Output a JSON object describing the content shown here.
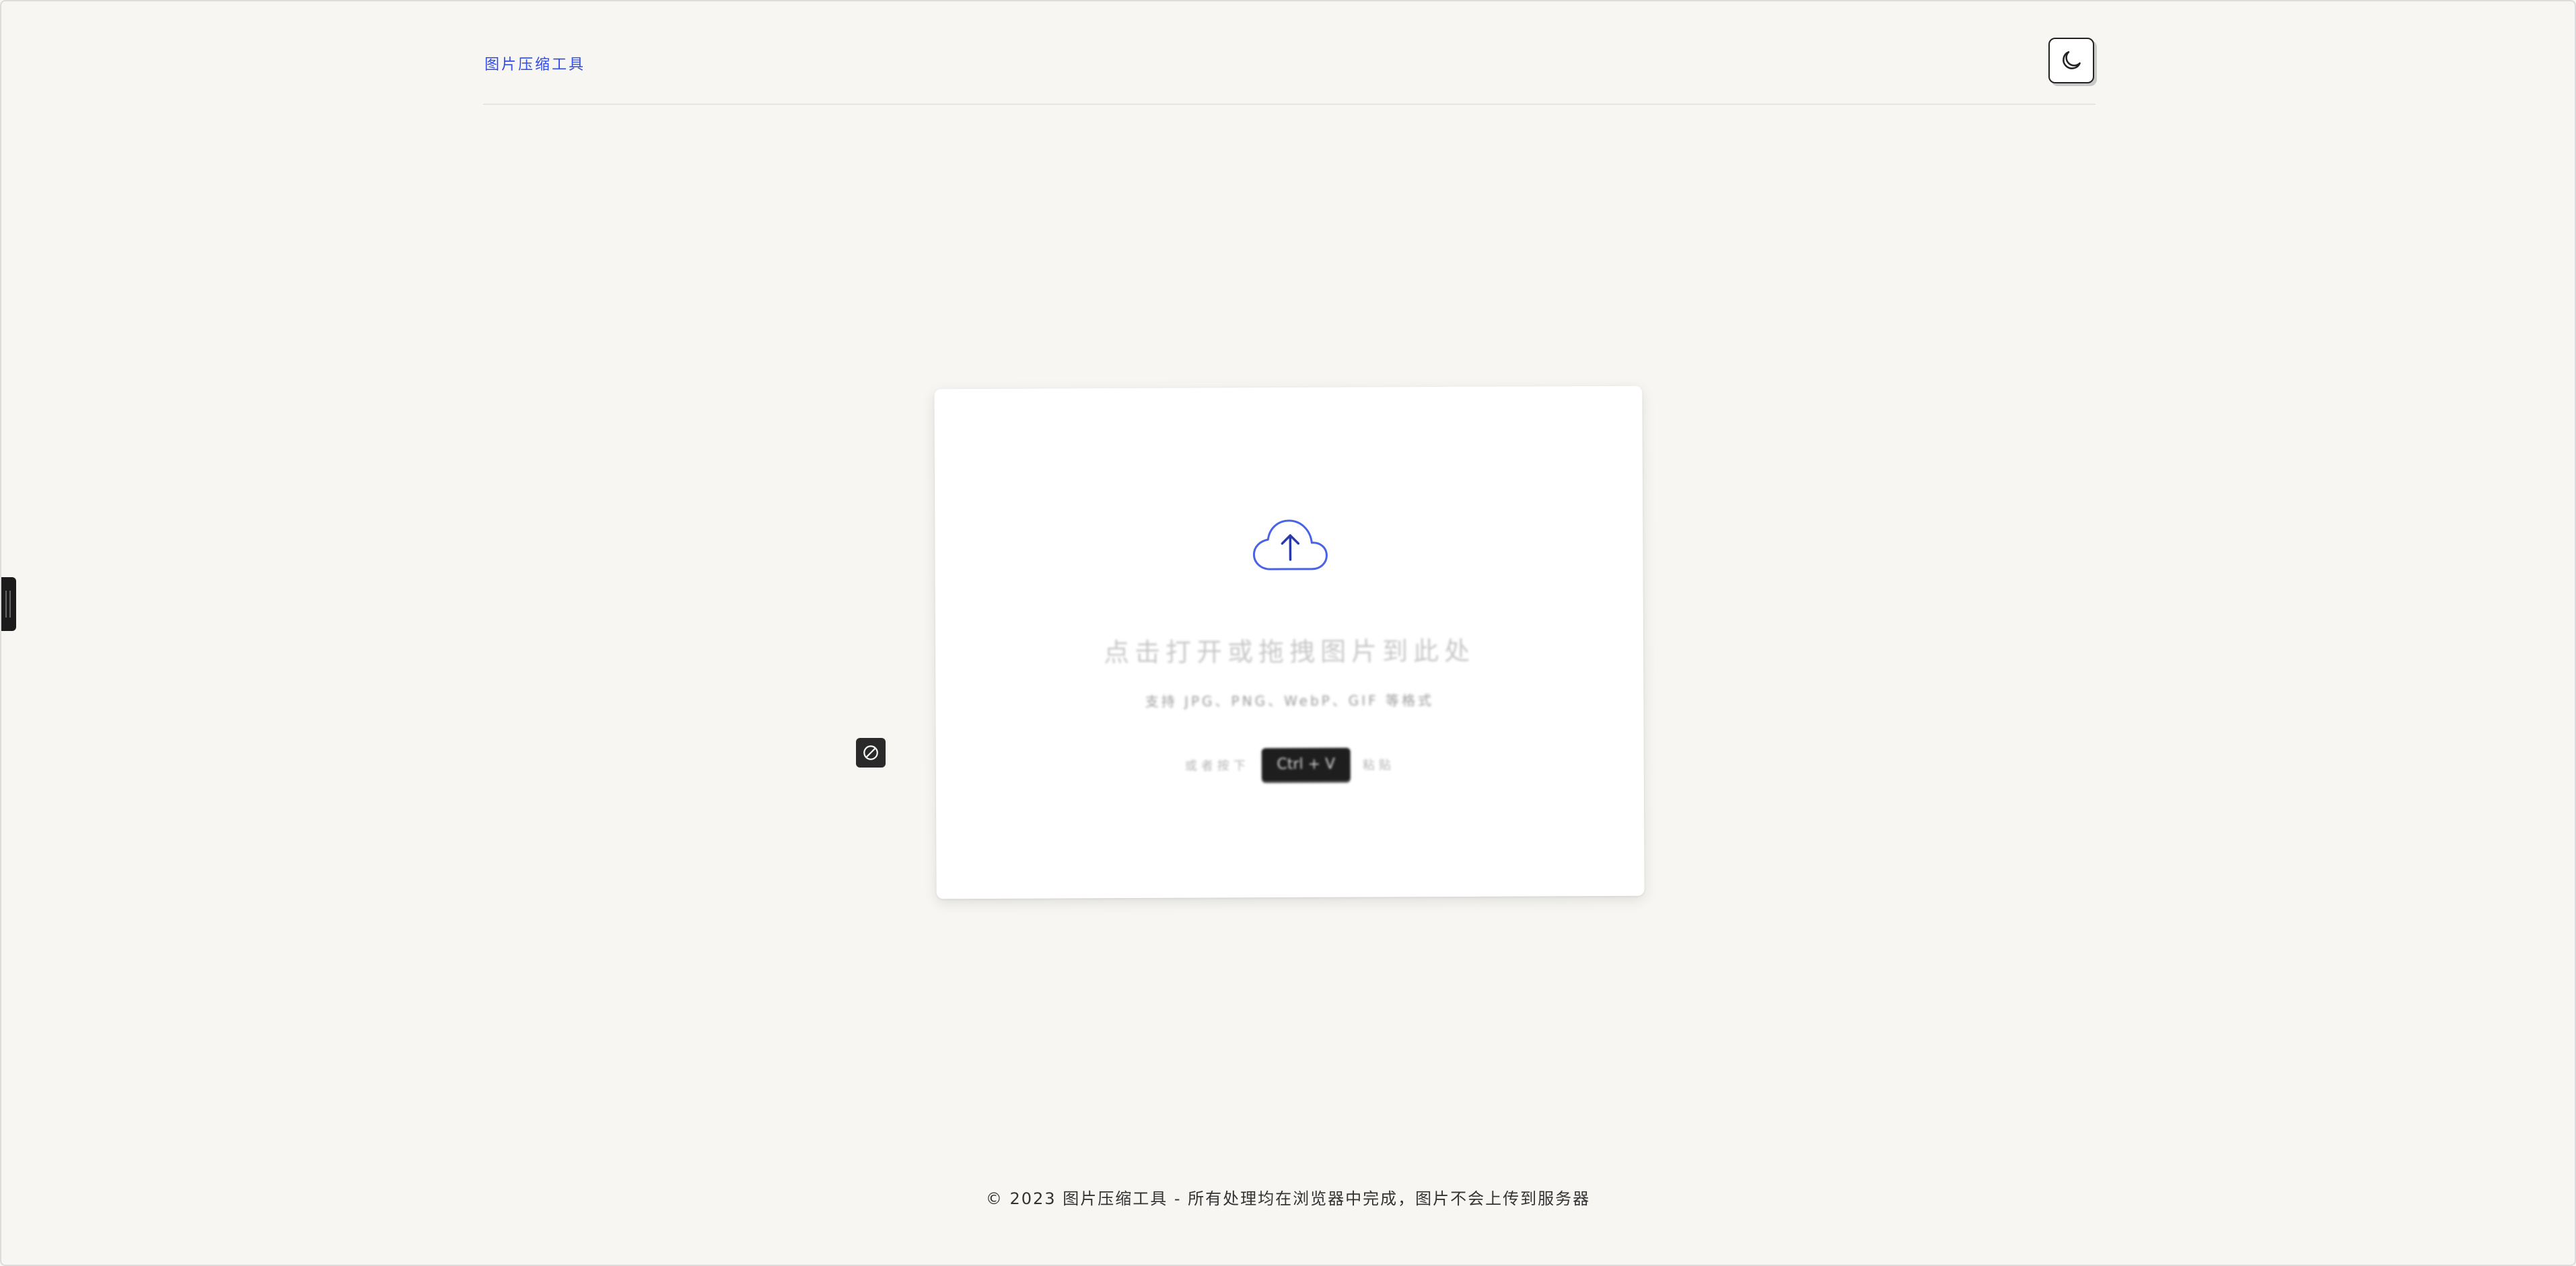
{
  "header": {
    "brand": "图片压缩工具",
    "theme_toggle_icon": "moon-icon"
  },
  "upload": {
    "icon": "cloud-upload-icon",
    "title": "点击打开或拖拽图片到此处",
    "formats": "支持 JPG、PNG、WebP、GIF 等格式",
    "paste_prefix": "或者按下",
    "paste_key": "Ctrl + V",
    "paste_suffix": "粘贴"
  },
  "floating": {
    "block_icon": "block-icon"
  },
  "footer": {
    "text": "© 2023 图片压缩工具 - 所有处理均在浏览器中完成，图片不会上传到服务器"
  },
  "colors": {
    "accent": "#2f4be8",
    "background": "#f7f6f2",
    "cloud": "#4a63e6"
  }
}
